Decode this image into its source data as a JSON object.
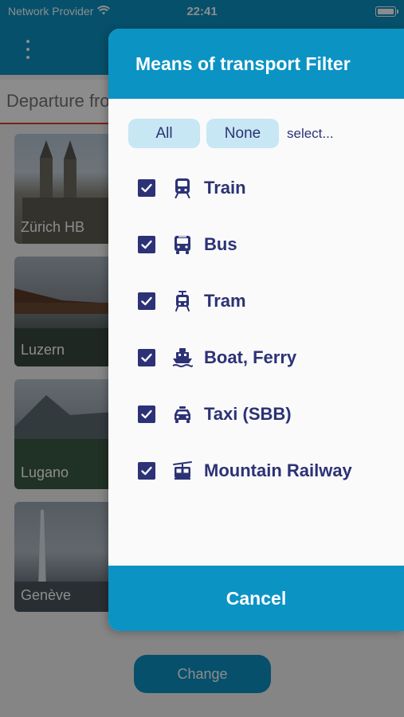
{
  "status": {
    "carrier": "Network Provider",
    "time": "22:41"
  },
  "departure": {
    "placeholder": "Departure from"
  },
  "cities": [
    {
      "name": "Zürich HB"
    },
    {
      "name": "Luzern"
    },
    {
      "name": "Lugano"
    },
    {
      "name": "Genève"
    }
  ],
  "change_label": "Change",
  "modal": {
    "title": "Means of transport Filter",
    "all_label": "All",
    "none_label": "None",
    "select_hint": "select...",
    "options": [
      {
        "label": "Train",
        "icon": "train-icon",
        "checked": true
      },
      {
        "label": "Bus",
        "icon": "bus-icon",
        "checked": true
      },
      {
        "label": "Tram",
        "icon": "tram-icon",
        "checked": true
      },
      {
        "label": "Boat, Ferry",
        "icon": "boat-icon",
        "checked": true
      },
      {
        "label": "Taxi (SBB)",
        "icon": "taxi-icon",
        "checked": true
      },
      {
        "label": "Mountain Railway",
        "icon": "cable-car-icon",
        "checked": true
      }
    ],
    "cancel_label": "Cancel"
  },
  "colors": {
    "primary": "#0b93c4",
    "navy": "#2c3275",
    "pill": "#c7e7f4",
    "accent_red": "#e23c2a"
  }
}
